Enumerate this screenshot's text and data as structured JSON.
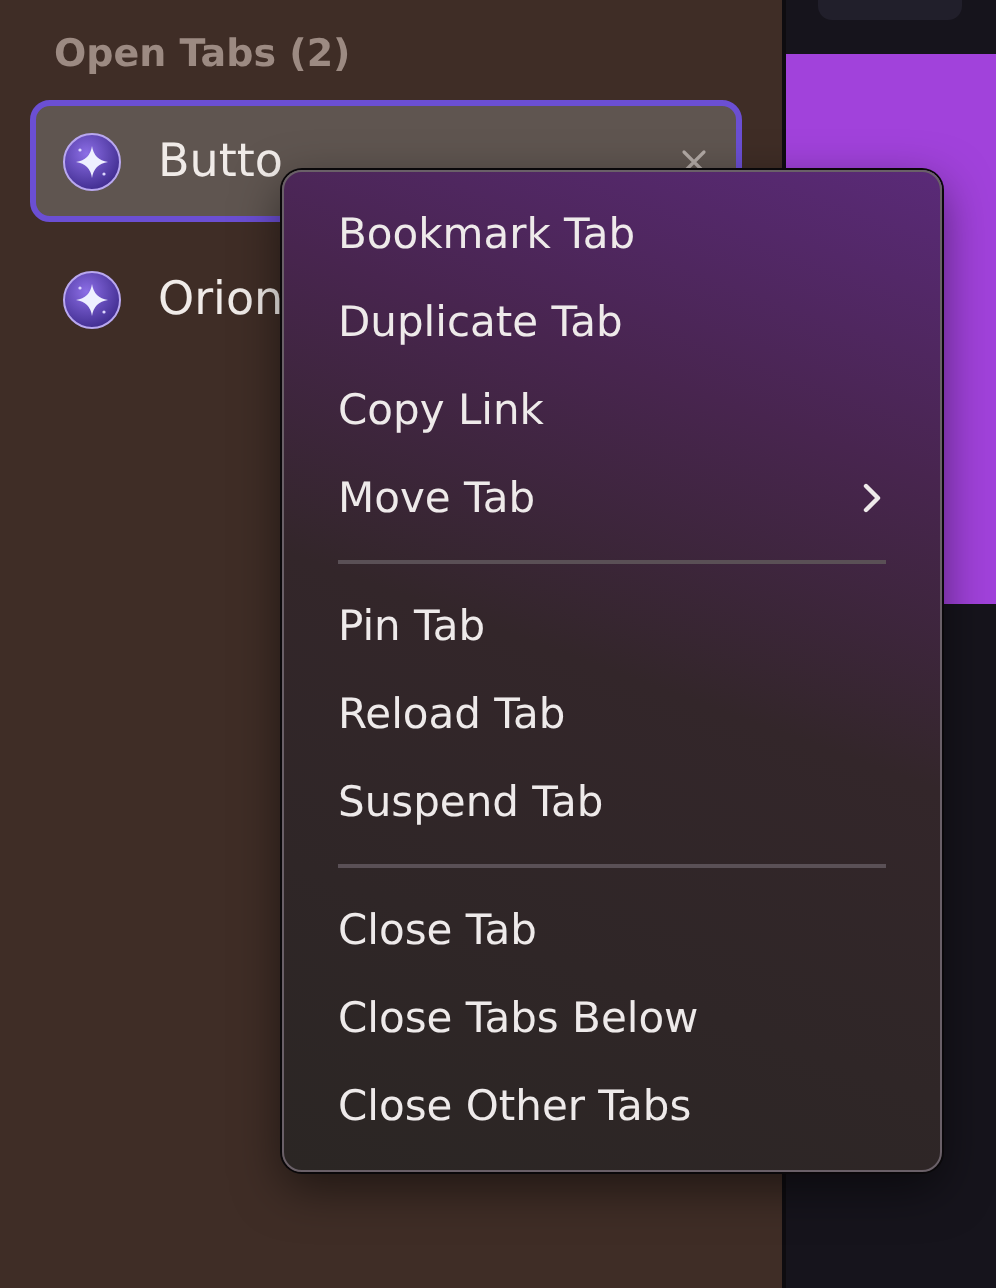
{
  "sidebar": {
    "heading": "Open Tabs (2)",
    "tabs": [
      {
        "title": "Butto",
        "selected": true,
        "closable": true
      },
      {
        "title": "Orion",
        "selected": false,
        "closable": false
      }
    ]
  },
  "context_menu": {
    "groups": [
      [
        {
          "label": "Bookmark Tab",
          "kind": "item"
        },
        {
          "label": "Duplicate Tab",
          "kind": "item"
        },
        {
          "label": "Copy Link",
          "kind": "item"
        },
        {
          "label": "Move Tab",
          "kind": "submenu"
        }
      ],
      [
        {
          "label": "Pin Tab",
          "kind": "item"
        },
        {
          "label": "Reload Tab",
          "kind": "item"
        },
        {
          "label": "Suspend Tab",
          "kind": "item"
        }
      ],
      [
        {
          "label": "Close Tab",
          "kind": "item"
        },
        {
          "label": "Close Tabs Below",
          "kind": "item"
        },
        {
          "label": "Close Other Tabs",
          "kind": "item"
        }
      ]
    ]
  }
}
